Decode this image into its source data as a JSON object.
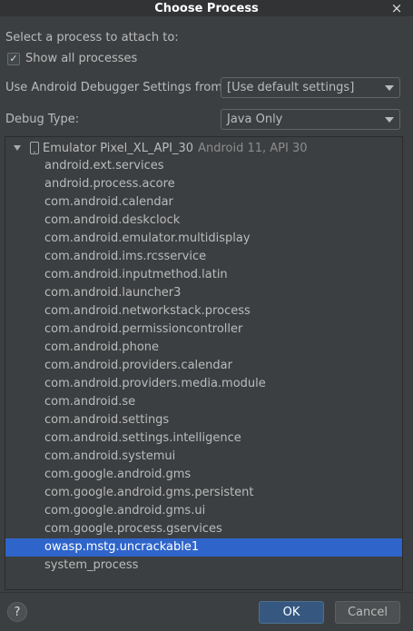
{
  "dialog": {
    "title": "Choose Process",
    "close_icon": "×"
  },
  "select_label": "Select a process to attach to:",
  "show_all": {
    "label": "Show all processes",
    "checked": true
  },
  "debugger_settings": {
    "label": "Use Android Debugger Settings from:",
    "value": "[Use default settings]"
  },
  "debug_type": {
    "label": "Debug Type:",
    "value": "Java Only"
  },
  "tree": {
    "device_name": "Emulator Pixel_XL_API_30",
    "device_extra": "Android 11, API 30",
    "processes": [
      "android.ext.services",
      "android.process.acore",
      "com.android.calendar",
      "com.android.deskclock",
      "com.android.emulator.multidisplay",
      "com.android.ims.rcsservice",
      "com.android.inputmethod.latin",
      "com.android.launcher3",
      "com.android.networkstack.process",
      "com.android.permissioncontroller",
      "com.android.phone",
      "com.android.providers.calendar",
      "com.android.providers.media.module",
      "com.android.se",
      "com.android.settings",
      "com.android.settings.intelligence",
      "com.android.systemui",
      "com.google.android.gms",
      "com.google.android.gms.persistent",
      "com.google.android.gms.ui",
      "com.google.process.gservices",
      "owasp.mstg.uncrackable1",
      "system_process"
    ],
    "selected_index": 21
  },
  "buttons": {
    "help": "?",
    "ok": "OK",
    "cancel": "Cancel"
  },
  "colors": {
    "background": "#3c3f41",
    "selection": "#2f65ca",
    "ok_button": "#365880"
  }
}
